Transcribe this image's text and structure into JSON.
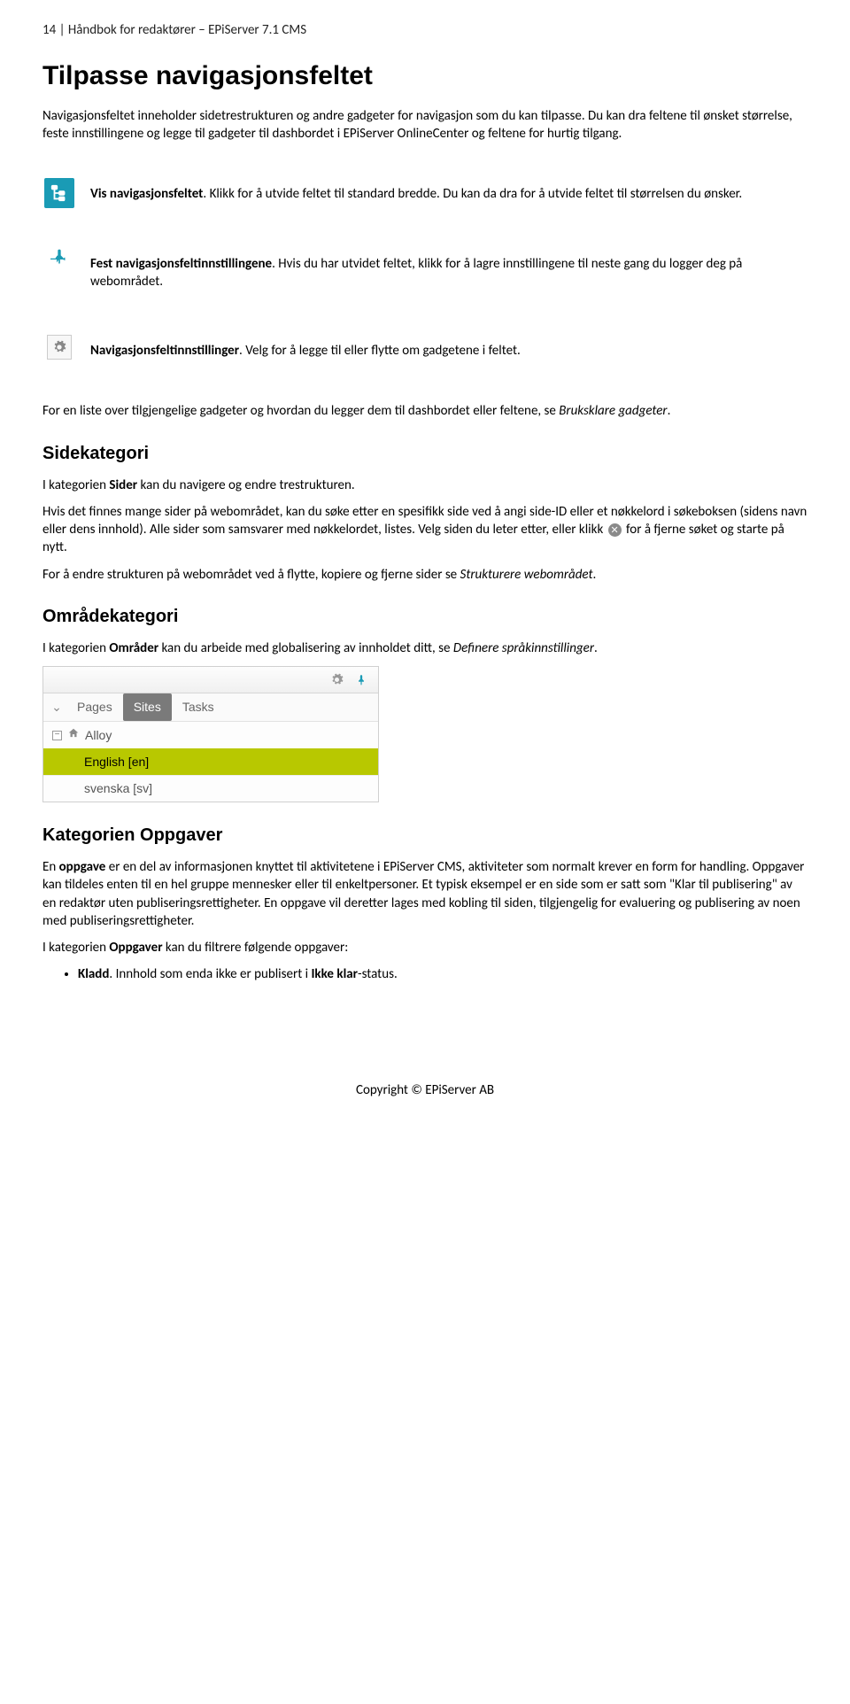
{
  "header": "14 | Håndbok for redaktører – EPiServer 7.1 CMS",
  "h1": "Tilpasse navigasjonsfeltet",
  "intro1": "Navigasjonsfeltet inneholder sidetrestrukturen og andre gadgeter for navigasjon som du kan tilpasse. Du kan dra feltene til ønsket størrelse, feste innstillingene og legge til gadgeter til dashbordet i EPiServer OnlineCenter og feltene for hurtig tilgang.",
  "row1_bold": "Vis navigasjonsfeltet",
  "row1_rest": ". Klikk for å utvide feltet til standard bredde. Du kan da dra for å utvide feltet til størrelsen du ønsker.",
  "row2_bold": "Fest navigasjonsfeltinnstillingene",
  "row2_rest": ". Hvis du har utvidet feltet, klikk for å lagre innstillingene til neste gang du logger deg på webområdet.",
  "row3_bold": "Navigasjonsfeltinnstillinger",
  "row3_rest": ". Velg for å legge til eller flytte om gadgetene i feltet.",
  "gadgets_pre": "For en liste over tilgjengelige gadgeter og hvordan du legger dem til dashbordet eller feltene, se ",
  "gadgets_link": "Bruksklare gadgeter",
  "gadgets_post": ".",
  "h2_side": "Sidekategori",
  "side_p1_a": "I kategorien ",
  "side_p1_bold": "Sider",
  "side_p1_b": " kan du navigere og endre trestrukturen.",
  "side_p2": "Hvis det finnes mange sider på webområdet, kan du søke etter en spesifikk side ved å angi side-ID eller et nøkkelord i søkeboksen (sidens navn eller dens innhold). Alle sider som samsvarer med nøkkelordet, listes. Velg siden du leter etter, eller klikk ",
  "side_p2_after": " for å fjerne søket og starte på nytt.",
  "side_p3_a": "For å endre strukturen på webområdet ved å flytte, kopiere og fjerne sider se ",
  "side_p3_link": "Strukturere webområdet",
  "side_p3_b": ".",
  "h2_omr": "Områdekategori",
  "omr_p1_a": "I kategorien ",
  "omr_p1_bold": "Områder",
  "omr_p1_b": " kan du arbeide med globalisering av innholdet ditt, se ",
  "omr_p1_link": "Definere språkinnstillinger",
  "omr_p1_c": ".",
  "panel": {
    "tabs": [
      "Pages",
      "Sites",
      "Tasks"
    ],
    "active_tab_index": 1,
    "root": "Alloy",
    "children": [
      "English [en]",
      "svenska [sv]"
    ],
    "selected_child_index": 0
  },
  "h2_opp": "Kategorien Oppgaver",
  "opp_p1_a": "En ",
  "opp_p1_bold": "oppgave",
  "opp_p1_b": " er en del av informasjonen knyttet til aktivitetene i EPiServer CMS, aktiviteter som normalt krever en form for handling. Oppgaver kan tildeles enten til en hel gruppe mennesker eller til enkeltpersoner. Et typisk eksempel er en side som er satt som \"Klar til publisering\" av en redaktør uten publiseringsrettigheter. En oppgave vil deretter lages med kobling til siden, tilgjengelig for evaluering og publisering av noen med publiseringsrettigheter.",
  "opp_p2_a": "I kategorien ",
  "opp_p2_bold": "Oppgaver",
  "opp_p2_b": " kan du filtrere følgende oppgaver:",
  "bullet_bold": "Kladd",
  "bullet_rest": ". Innhold som enda ikke er publisert i ",
  "bullet_bold2": "Ikke klar",
  "bullet_after": "-status.",
  "copyright": "Copyright © EPiServer AB"
}
